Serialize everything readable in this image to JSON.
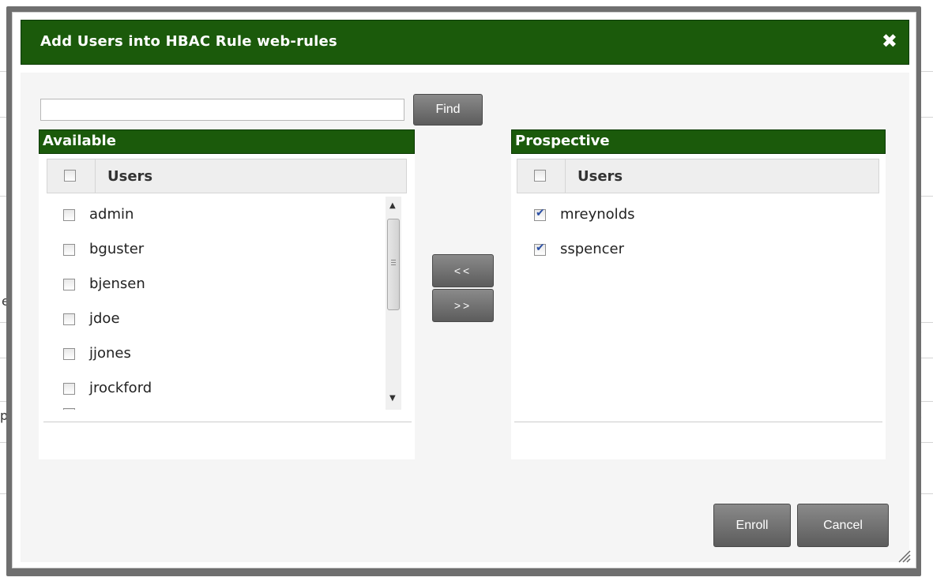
{
  "background": {
    "fragment_left_1": "e",
    "fragment_left_2": "ps"
  },
  "dialog": {
    "title": "Add Users into HBAC Rule web-rules",
    "close_glyph": "✖"
  },
  "search": {
    "value": "",
    "placeholder": "",
    "find_label": "Find"
  },
  "available": {
    "header": "Available",
    "column_label": "Users",
    "items": [
      {
        "label": "admin",
        "checked": false
      },
      {
        "label": "bguster",
        "checked": false
      },
      {
        "label": "bjensen",
        "checked": false
      },
      {
        "label": "jdoe",
        "checked": false
      },
      {
        "label": "jjones",
        "checked": false
      },
      {
        "label": "jrockford",
        "checked": false
      }
    ]
  },
  "prospective": {
    "header": "Prospective",
    "column_label": "Users",
    "items": [
      {
        "label": "mreynolds",
        "checked": true
      },
      {
        "label": "sspencer",
        "checked": true
      }
    ]
  },
  "actions": {
    "move_left_label": "<<",
    "move_right_label": ">>",
    "enroll_label": "Enroll",
    "cancel_label": "Cancel"
  },
  "colors": {
    "header_green": "#1b5a0b",
    "button_gray": "#6e6e6e",
    "checkmark_blue": "#2b4fa5"
  },
  "icons": {
    "close": "close-icon",
    "chevron_right": "chevron-right-icon",
    "scroll_up": "scroll-up-arrow-icon",
    "scroll_down": "scroll-down-arrow-icon",
    "resize": "resize-grip-icon"
  }
}
